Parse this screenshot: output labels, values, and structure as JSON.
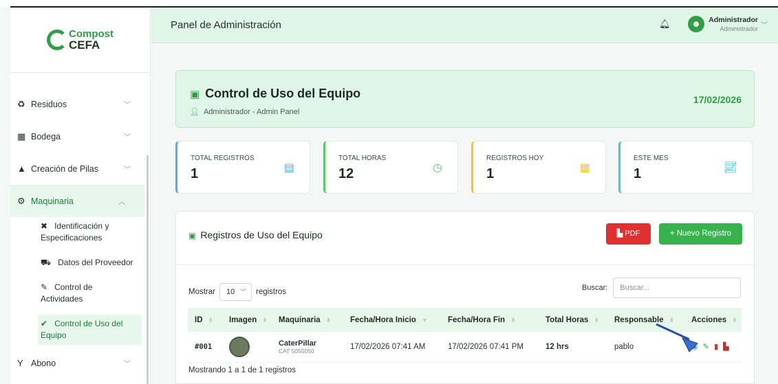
{
  "brand": {
    "line1": "Compost",
    "line2": "CEFA"
  },
  "sidebar": {
    "items": [
      {
        "label": "Residuos"
      },
      {
        "label": "Bodega"
      },
      {
        "label": "Creación de Pilas"
      },
      {
        "label": "Maquinaria"
      },
      {
        "label": "Abono"
      }
    ],
    "sub_items": [
      {
        "label": "Identificación y Especificaciones"
      },
      {
        "label": "Datos del Proveedor"
      },
      {
        "label": "Control de Actividades"
      },
      {
        "label": "Control de Uso del Equipo"
      }
    ]
  },
  "header": {
    "title": "Panel de Administración",
    "user_name": "Administrador",
    "user_role": "Administrador"
  },
  "banner": {
    "title": "Control de Uso del Equipo",
    "subtitle": "Administrador - Admin Panel",
    "date": "17/02/2026"
  },
  "stats": [
    {
      "label": "TOTAL REGISTROS",
      "value": "1",
      "color": "#4dabf7"
    },
    {
      "label": "TOTAL HORAS",
      "value": "12",
      "color": "#51cf66"
    },
    {
      "label": "REGISTROS HOY",
      "value": "1",
      "color": "#fcc419"
    },
    {
      "label": "ESTE MES",
      "value": "1",
      "color": "#3bc9db"
    }
  ],
  "panel": {
    "title": "Registros de Uso del Equipo",
    "pdf_label": "PDF",
    "new_label": "+ Nuevo Registro",
    "show_label": "Mostrar",
    "page_size": "10",
    "records_label": "registros",
    "search_label": "Buscar:",
    "search_placeholder": "Buscar...",
    "footer": "Mostrando 1 a 1 de 1 registros"
  },
  "table": {
    "columns": [
      "ID",
      "Imagen",
      "Maquinaria",
      "Fecha/Hora Inicio",
      "Fecha/Hora Fin",
      "Total Horas",
      "Responsable",
      "Acciones"
    ],
    "rows": [
      {
        "id": "#001",
        "machine": "CaterPillar",
        "model": "CAT 5055050",
        "start": "17/02/2026 07:41 AM",
        "end": "17/02/2026 07:41 PM",
        "hours": "12 hrs",
        "responsible": "pablo"
      }
    ]
  }
}
